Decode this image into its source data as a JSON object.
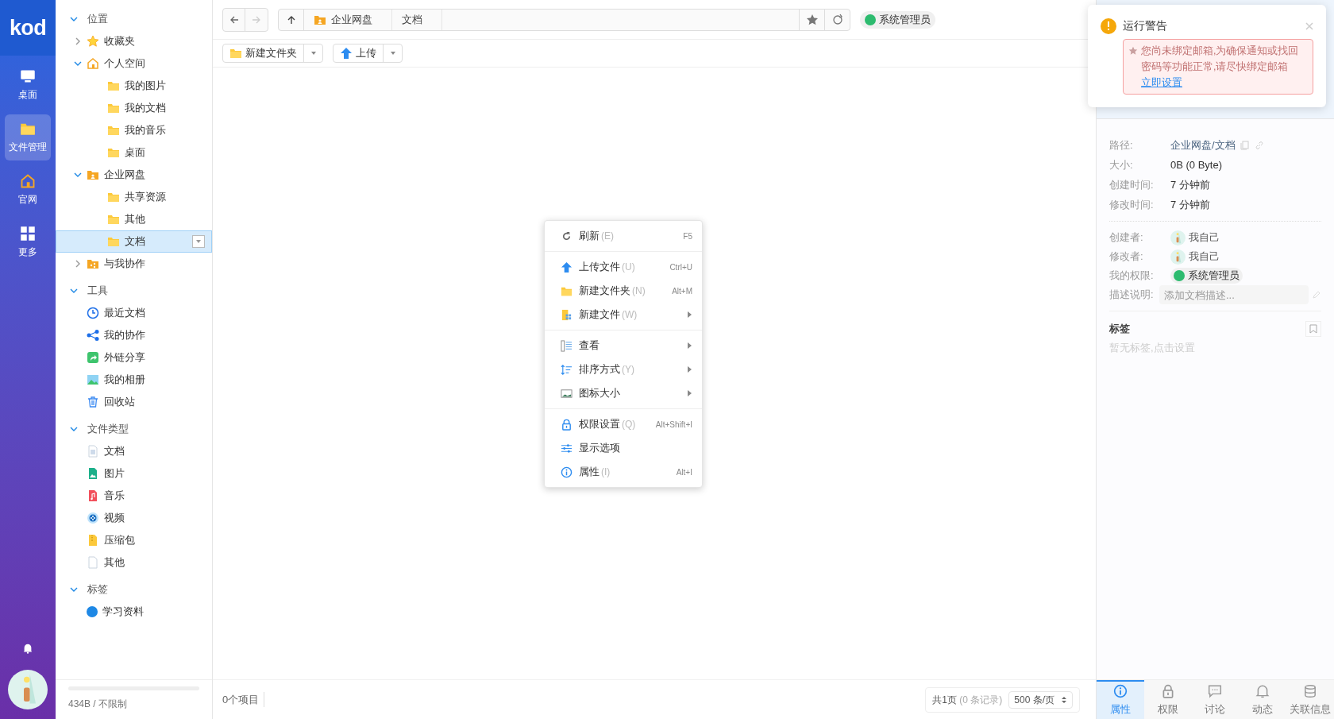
{
  "nav": {
    "logo": "kod",
    "items": [
      {
        "label": "桌面",
        "kind": "desktop",
        "selected": false
      },
      {
        "label": "文件管理",
        "kind": "folder",
        "selected": true
      },
      {
        "label": "官网",
        "kind": "home",
        "selected": false
      },
      {
        "label": "更多",
        "kind": "grid",
        "selected": false
      }
    ]
  },
  "sidebar": {
    "sections": [
      {
        "title": "位置",
        "expanded": true,
        "items": [
          {
            "label": "收藏夹",
            "kind": "star",
            "expanded": false,
            "selected": false
          },
          {
            "label": "个人空间",
            "kind": "home",
            "expanded": true,
            "selected": false,
            "children": [
              {
                "label": "我的图片",
                "kind": "folder",
                "selected": false
              },
              {
                "label": "我的文档",
                "kind": "folder",
                "selected": false
              },
              {
                "label": "我的音乐",
                "kind": "folder",
                "selected": false
              },
              {
                "label": "桌面",
                "kind": "folder",
                "selected": false
              }
            ]
          },
          {
            "label": "企业网盘",
            "kind": "group",
            "expanded": true,
            "selected": false,
            "children": [
              {
                "label": "共享资源",
                "kind": "folder",
                "selected": false
              },
              {
                "label": "其他",
                "kind": "folder",
                "selected": false
              },
              {
                "label": "文档",
                "kind": "folder",
                "selected": true
              }
            ]
          },
          {
            "label": "与我协作",
            "kind": "share-folder",
            "expanded": false,
            "selected": false
          }
        ]
      },
      {
        "title": "工具",
        "expanded": true,
        "items": [
          {
            "label": "最近文档",
            "kind": "clock",
            "selected": false
          },
          {
            "label": "我的协作",
            "kind": "share",
            "selected": false
          },
          {
            "label": "外链分享",
            "kind": "link",
            "selected": false
          },
          {
            "label": "我的相册",
            "kind": "photo",
            "selected": false
          },
          {
            "label": "回收站",
            "kind": "trash",
            "selected": false
          }
        ]
      },
      {
        "title": "文件类型",
        "expanded": true,
        "items": [
          {
            "label": "文档",
            "kind": "doc",
            "selected": false
          },
          {
            "label": "图片",
            "kind": "image",
            "selected": false
          },
          {
            "label": "音乐",
            "kind": "music",
            "selected": false
          },
          {
            "label": "视频",
            "kind": "video",
            "selected": false
          },
          {
            "label": "压缩包",
            "kind": "zip",
            "selected": false
          },
          {
            "label": "其他",
            "kind": "file",
            "selected": false
          }
        ]
      },
      {
        "title": "标签",
        "expanded": true,
        "items": [
          {
            "label": "学习资料",
            "kind": "tag",
            "color": "#1e88e5",
            "selected": false
          }
        ]
      }
    ],
    "storage": {
      "text": "434B / 不限制"
    }
  },
  "toolbar": {
    "breadcrumbs": [
      "企业网盘",
      "文档"
    ],
    "role": "系统管理员",
    "actions": [
      {
        "label": "新建文件夹",
        "kind": "folder"
      },
      {
        "label": "上传",
        "kind": "upload"
      }
    ]
  },
  "status": {
    "count": "0个项目",
    "pages": "共1页",
    "records": "(0 条记录)",
    "per_page": "500 条/页"
  },
  "context_menu": {
    "groups": [
      [
        {
          "label": "刷新",
          "key": "(E)",
          "shortcut": "F5",
          "kind": "refresh",
          "submenu": false
        }
      ],
      [
        {
          "label": "上传文件",
          "key": "(U)",
          "shortcut": "Ctrl+U",
          "kind": "upload",
          "submenu": false
        },
        {
          "label": "新建文件夹",
          "key": "(N)",
          "shortcut": "Alt+M",
          "kind": "folder",
          "submenu": false
        },
        {
          "label": "新建文件",
          "key": "(W)",
          "kind": "newfile",
          "submenu": true
        }
      ],
      [
        {
          "label": "查看",
          "kind": "list",
          "submenu": true
        },
        {
          "label": "排序方式",
          "key": "(Y)",
          "kind": "sort",
          "submenu": true
        },
        {
          "label": "图标大小",
          "kind": "picture",
          "submenu": true
        }
      ],
      [
        {
          "label": "权限设置",
          "key": "(Q)",
          "shortcut": "Alt+Shift+I",
          "kind": "lock",
          "submenu": false
        },
        {
          "label": "显示选项",
          "kind": "sliders",
          "submenu": false
        },
        {
          "label": "属性",
          "key": "(I)",
          "shortcut": "Alt+I",
          "kind": "info",
          "submenu": false
        }
      ]
    ]
  },
  "panel": {
    "props": [
      {
        "label": "路径:",
        "value": "企业网盘/文档",
        "kind": "path"
      },
      {
        "label": "大小:",
        "value": "0B (0 Byte)",
        "kind": "text"
      },
      {
        "label": "创建时间:",
        "value": "7 分钟前",
        "kind": "text"
      },
      {
        "label": "修改时间:",
        "value": "7 分钟前",
        "kind": "text"
      }
    ],
    "people": [
      {
        "label": "创建者:",
        "value": "我自己",
        "kind": "user"
      },
      {
        "label": "修改者:",
        "value": "我自己",
        "kind": "user"
      },
      {
        "label": "我的权限:",
        "value": "系统管理员",
        "kind": "role"
      },
      {
        "label": "描述说明:",
        "placeholder": "添加文档描述...",
        "kind": "input"
      }
    ],
    "tags_title": "标签",
    "tags_empty": "暂无标签,点击设置",
    "tabs": [
      {
        "label": "属性",
        "kind": "info",
        "selected": true
      },
      {
        "label": "权限",
        "kind": "lock",
        "selected": false
      },
      {
        "label": "讨论",
        "kind": "chat",
        "selected": false
      },
      {
        "label": "动态",
        "kind": "bell",
        "selected": false
      },
      {
        "label": "关联信息",
        "kind": "db",
        "selected": false
      }
    ]
  },
  "toast": {
    "title": "运行警告",
    "message": "您尚未绑定邮箱,为确保通知或找回密码等功能正常,请尽快绑定邮箱",
    "link": "立即设置"
  }
}
